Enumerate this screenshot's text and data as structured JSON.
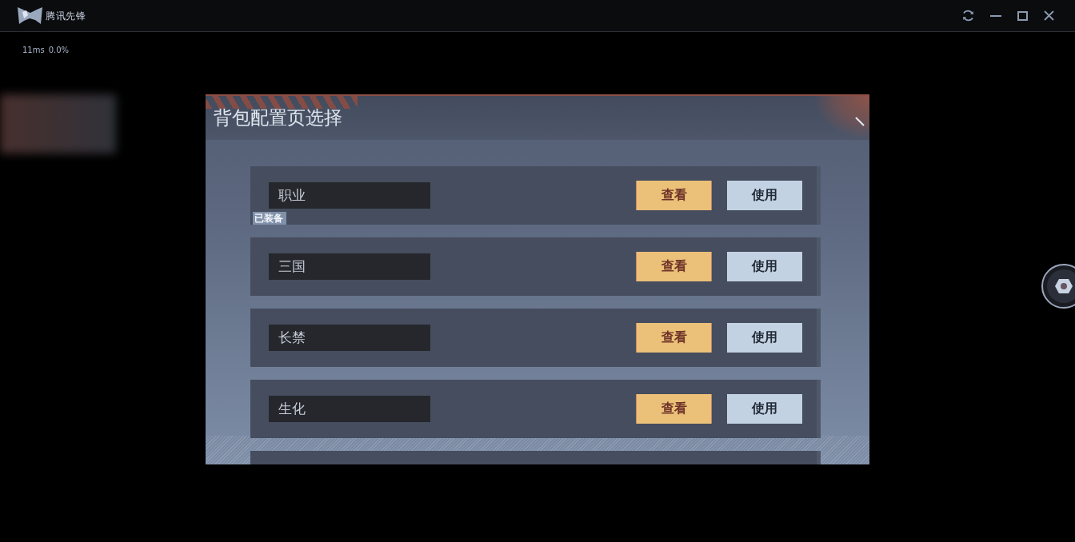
{
  "titlebar": {
    "app_name": "腾讯先锋"
  },
  "stats": [
    "11ms",
    "0.0%"
  ],
  "dialog": {
    "title": "背包配置页选择",
    "equipped_label": "已装备",
    "rows": [
      {
        "name": "职业",
        "equipped": true,
        "view_button": "查看",
        "use_button": "使用"
      },
      {
        "name": "三国",
        "equipped": false,
        "view_button": "查看",
        "use_button": "使用"
      },
      {
        "name": "长禁",
        "equipped": false,
        "view_button": "查看",
        "use_button": "使用"
      },
      {
        "name": "生化",
        "equipped": false,
        "view_button": "查看",
        "use_button": "使用"
      }
    ]
  }
}
